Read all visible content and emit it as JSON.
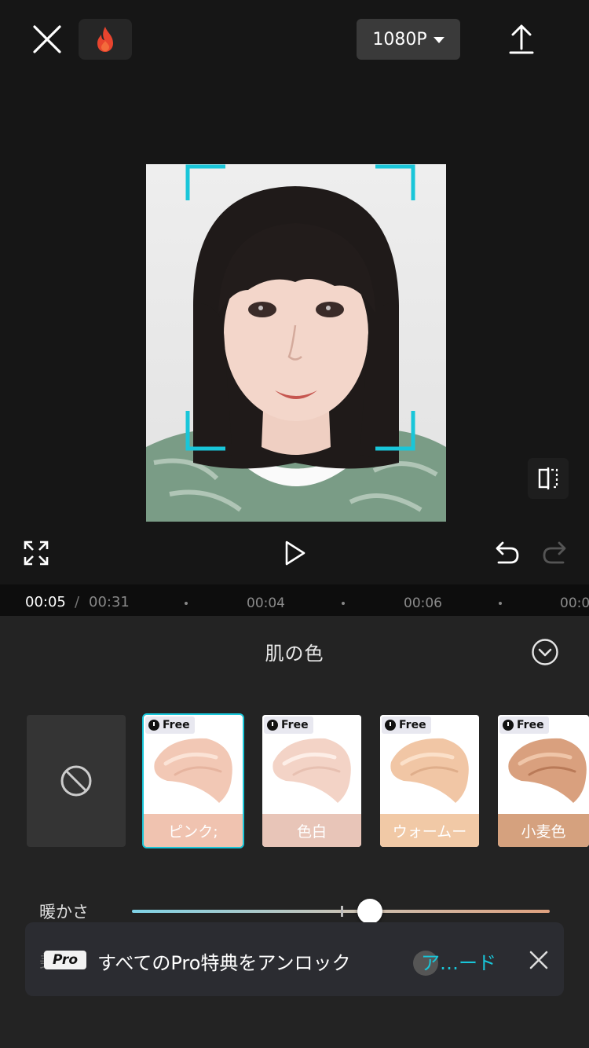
{
  "header": {
    "resolution": "1080P"
  },
  "timeline": {
    "current_time": "00:05",
    "separator": "/",
    "total_time": "00:31",
    "ticks": [
      "00:04",
      "00:06",
      "00:0"
    ]
  },
  "panel": {
    "title": "肌の色",
    "options": [
      {
        "label": "ピンク;",
        "badge": "Free",
        "color": "#f0c3b0",
        "selected": true
      },
      {
        "label": "色白",
        "badge": "Free",
        "color": "#e8c5b8",
        "selected": false
      },
      {
        "label": "ウォームー",
        "badge": "Free",
        "color": "#f1c9a6",
        "selected": false
      },
      {
        "label": "小麦色",
        "badge": "Free",
        "color": "#d5a17e",
        "selected": false
      }
    ],
    "slider": {
      "label": "暖かさ",
      "value_fraction": 0.57
    },
    "hidden_slider_label": "美"
  },
  "pro_banner": {
    "tag": "Pro",
    "text": "すべてのPro特典をアンロック",
    "link": "ア…ード"
  },
  "colors": {
    "accent": "#19c6d9",
    "background": "#161616",
    "panel": "#232323"
  },
  "icons": [
    "close-icon",
    "flame-icon",
    "caret-down-icon",
    "export-icon",
    "compare-icon",
    "fullscreen-icon",
    "play-icon",
    "undo-icon",
    "redo-icon",
    "collapse-icon",
    "none-icon",
    "clock-icon",
    "banner-close-icon"
  ]
}
